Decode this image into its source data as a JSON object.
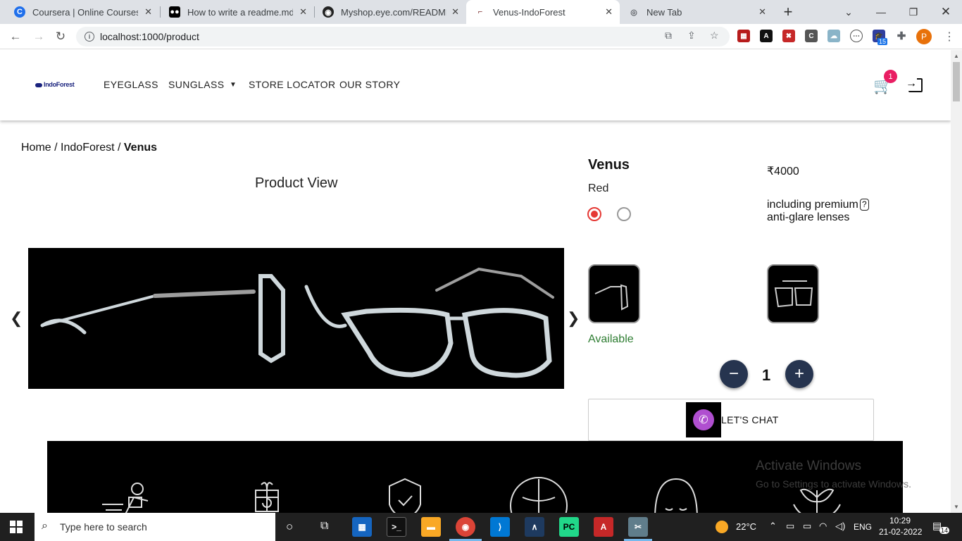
{
  "browser": {
    "tabs": [
      {
        "title": "Coursera | Online Courses & Cre",
        "icon": "coursera-icon"
      },
      {
        "title": "How to write a readme.md file? (",
        "icon": "medium-icon"
      },
      {
        "title": "Myshop.eye.com/README.md at",
        "icon": "github-icon"
      },
      {
        "title": "Venus-IndoForest",
        "icon": "glasses-favicon"
      },
      {
        "title": "New Tab",
        "icon": "chrome-icon"
      }
    ],
    "url": "localhost:1000/product",
    "extension_badge": "15",
    "profile_initial": "P"
  },
  "site": {
    "logo_text": "IndoForest",
    "nav": [
      "EYEGLASS",
      "SUNGLASS",
      "STORE LOCATOR",
      "OUR STORY"
    ],
    "cart_count": "1"
  },
  "breadcrumb": {
    "home": "Home",
    "sep": "/",
    "brand": "IndoForest",
    "current": "Venus"
  },
  "product": {
    "view_title": "Product View",
    "name": "Venus",
    "color": "Red",
    "price": "₹4000",
    "includes_line1": "including premium",
    "includes_line2": "anti-glare lenses",
    "help_mark": "?",
    "availability": "Available",
    "quantity": "1",
    "minus": "−",
    "plus": "+",
    "chat_label": "LET'S CHAT"
  },
  "watermark": {
    "line1": "Activate Windows",
    "line2": "Go to Settings to activate Windows."
  },
  "taskbar": {
    "search_placeholder": "Type here to search",
    "weather": "22°C",
    "lang": "ENG",
    "time": "10:29",
    "date": "21-02-2022",
    "notifications": "14"
  },
  "colors": {
    "accent_red": "#e53935",
    "available_green": "#2e7d32",
    "qty_button": "#26344f",
    "badge": "#e91e63"
  }
}
